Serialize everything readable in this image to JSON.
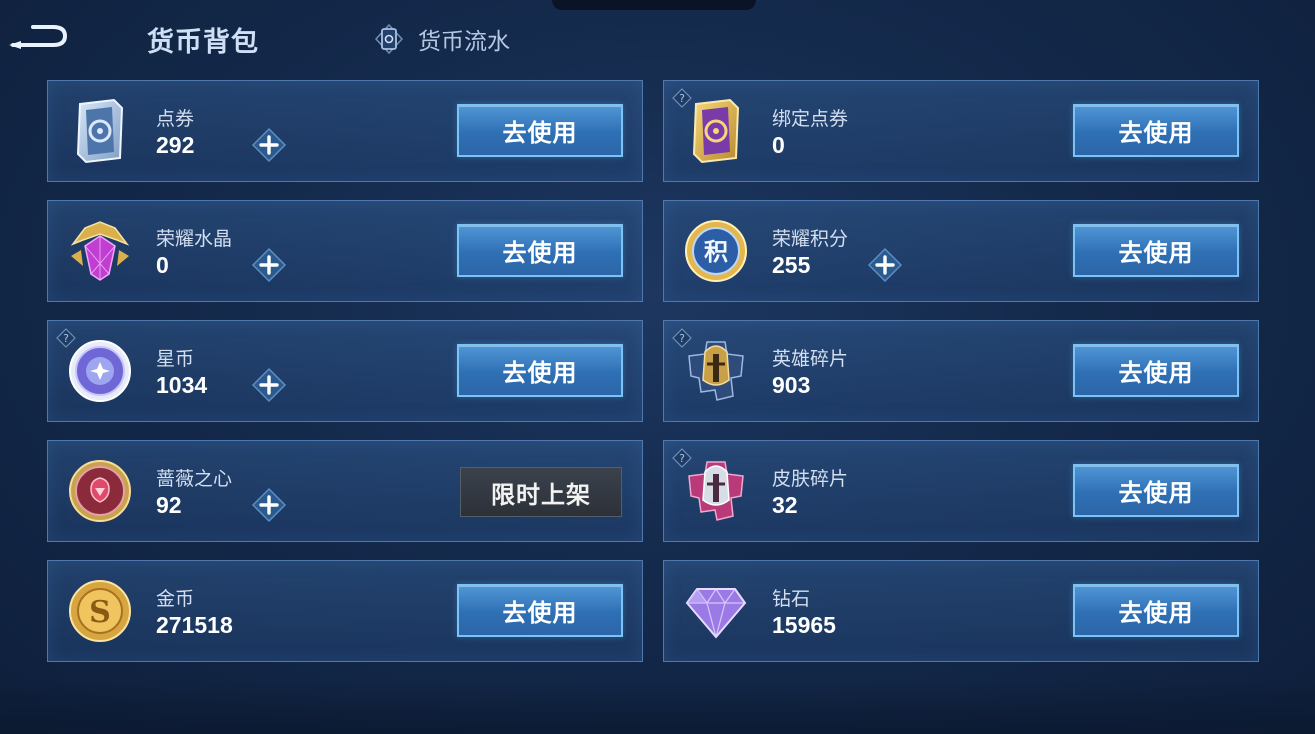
{
  "header": {
    "title": "货币背包",
    "flow_label": "货币流水"
  },
  "cards": [
    {
      "name": "点券",
      "value": "292",
      "button": "去使用",
      "icon": "coupon-card-icon"
    },
    {
      "name": "绑定点券",
      "value": "0",
      "button": "去使用",
      "icon": "bound-coupon-card-icon"
    },
    {
      "name": "荣耀水晶",
      "value": "0",
      "button": "去使用",
      "icon": "glory-crystal-icon"
    },
    {
      "name": "荣耀积分",
      "value": "255",
      "button": "去使用",
      "icon": "glory-points-icon"
    },
    {
      "name": "星币",
      "value": "1034",
      "button": "去使用",
      "icon": "star-coin-icon"
    },
    {
      "name": "英雄碎片",
      "value": "903",
      "button": "去使用",
      "icon": "hero-fragment-icon"
    },
    {
      "name": "蔷薇之心",
      "value": "92",
      "button": "限时上架",
      "icon": "rose-heart-icon"
    },
    {
      "name": "皮肤碎片",
      "value": "32",
      "button": "去使用",
      "icon": "skin-fragment-icon"
    },
    {
      "name": "金币",
      "value": "271518",
      "button": "去使用",
      "icon": "gold-coin-icon"
    },
    {
      "name": "钻石",
      "value": "15965",
      "button": "去使用",
      "icon": "diamond-icon"
    }
  ],
  "colors": {
    "background": "#142a4c",
    "card_border": "#4f79ad",
    "button": "#3a7fc4",
    "button_border": "#7ac3f2",
    "disabled_button": "#333941"
  }
}
